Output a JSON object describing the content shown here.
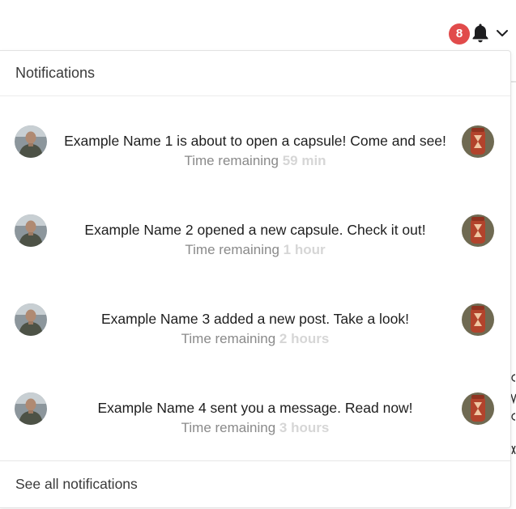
{
  "topbar": {
    "badge_count": "8",
    "bell_icon": "bell-icon",
    "caret_icon": "chevron-down-icon",
    "badge_color": "#e14b4b"
  },
  "dropdown": {
    "header": "Notifications",
    "footer_link": "See all notifications",
    "time_prefix": "Time remaining",
    "items": [
      {
        "message": "Example Name 1 is about to open a capsule! Come and see!",
        "remaining": "59 min"
      },
      {
        "message": "Example Name 2 opened a new capsule. Check it out!",
        "remaining": "1 hour"
      },
      {
        "message": "Example Name 3 added a new post. Take a look!",
        "remaining": "2 hours"
      },
      {
        "message": "Example Name 4 sent you a message. Read now!",
        "remaining": "3 hours"
      }
    ]
  }
}
